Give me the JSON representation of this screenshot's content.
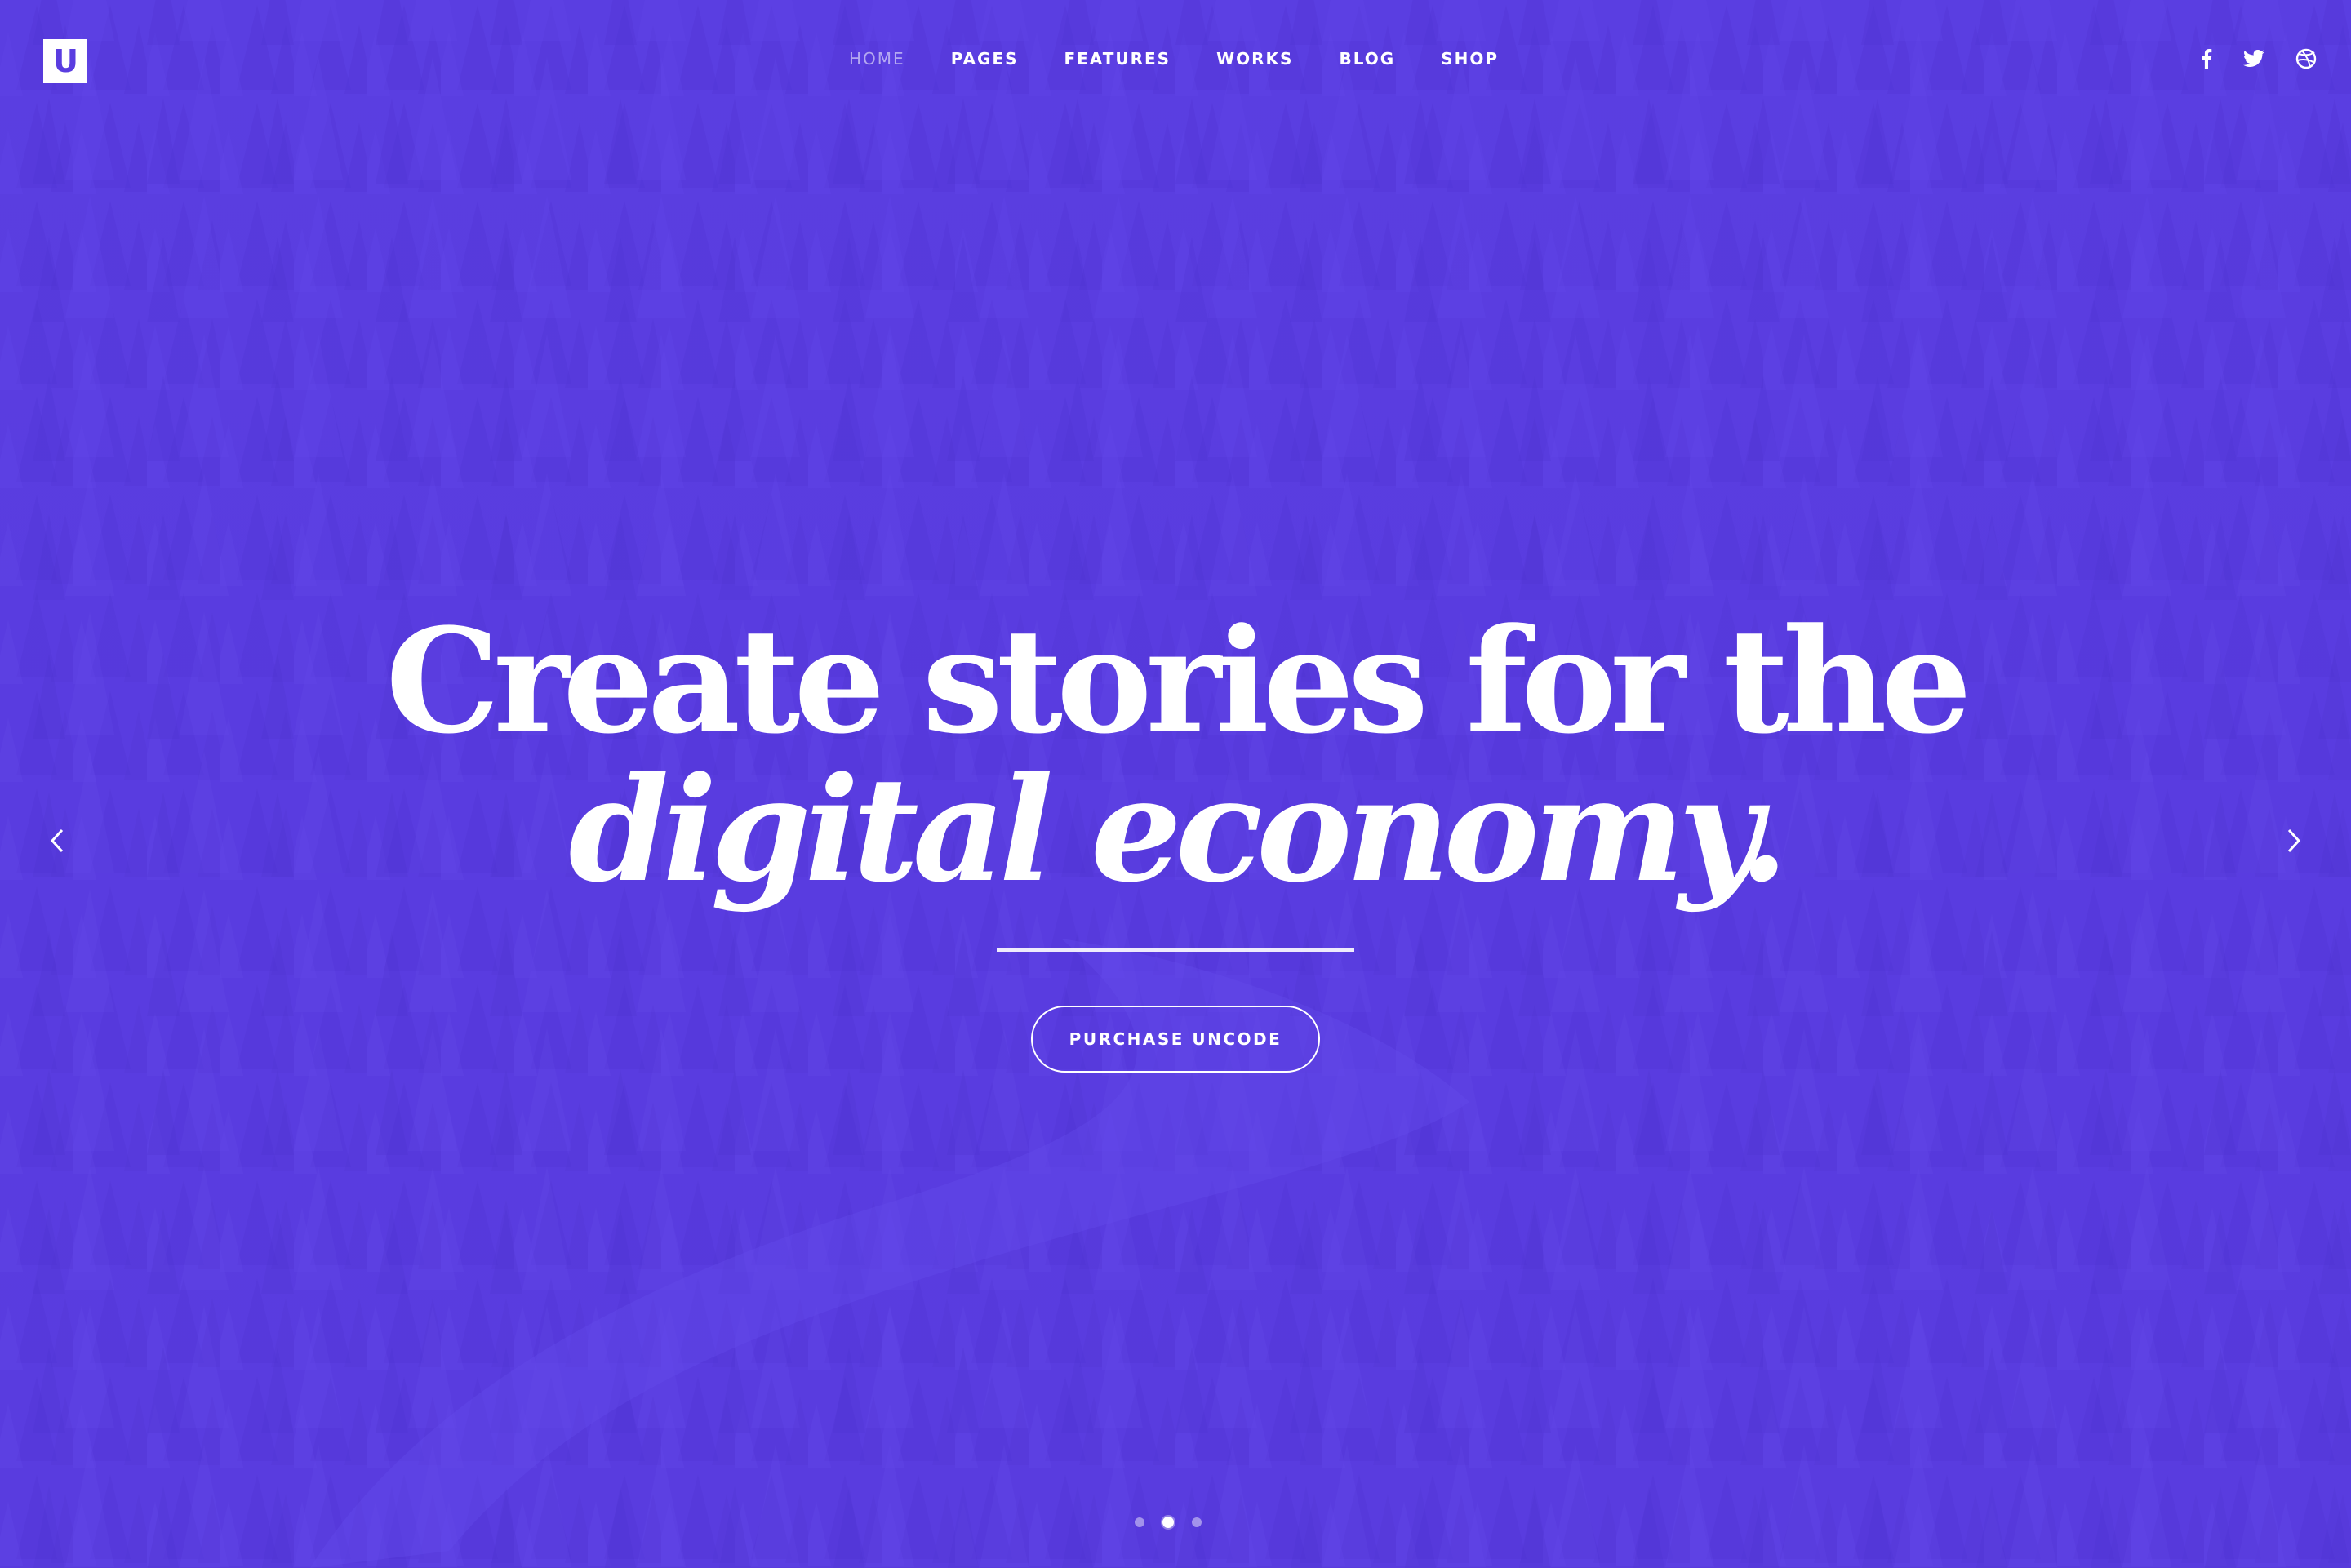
{
  "brand": {
    "logo_letter": "U",
    "accent_color": "#5a3de0"
  },
  "nav": {
    "items": [
      {
        "label": "HOME",
        "active": true
      },
      {
        "label": "PAGES",
        "active": false
      },
      {
        "label": "FEATURES",
        "active": false
      },
      {
        "label": "WORKS",
        "active": false
      },
      {
        "label": "BLOG",
        "active": false
      },
      {
        "label": "SHOP",
        "active": false
      }
    ]
  },
  "social": {
    "icons": [
      "facebook-icon",
      "twitter-icon",
      "dribbble-icon"
    ]
  },
  "hero": {
    "headline_line1": "Create stories for the",
    "headline_line2": "digital economy.",
    "cta_label": "PURCHASE UNCODE"
  },
  "slider": {
    "prev_icon": "chevron-left-icon",
    "next_icon": "chevron-right-icon",
    "slide_count": 3,
    "active_slide": 2
  }
}
